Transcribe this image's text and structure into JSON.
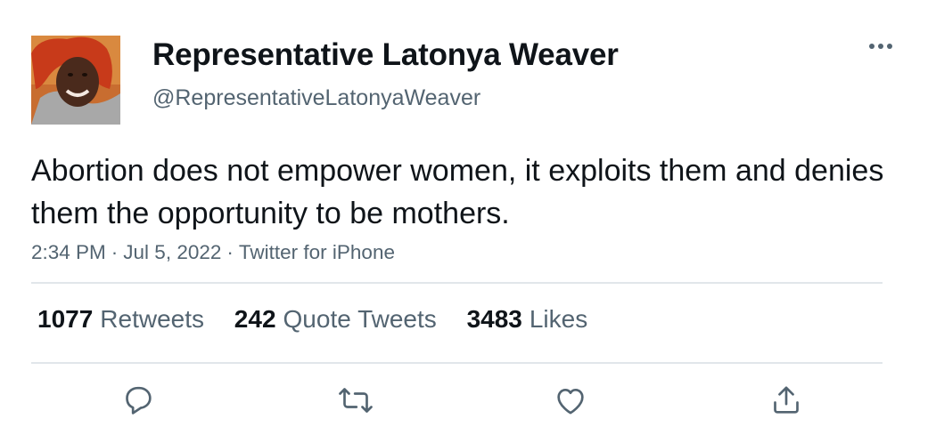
{
  "user": {
    "display_name": "Representative Latonya Weaver",
    "handle": "@RepresentativeLatonyaWeaver"
  },
  "tweet": {
    "text": "Abortion does not empower women, it exploits them and denies them the opportunity to be mothers.",
    "time": "2:34 PM",
    "date": "Jul 5, 2022",
    "source": "Twitter for iPhone",
    "separator": "·"
  },
  "stats": {
    "retweets": {
      "count": "1077",
      "label": "Retweets"
    },
    "quotes": {
      "count": "242",
      "label": "Quote Tweets"
    },
    "likes": {
      "count": "3483",
      "label": "Likes"
    }
  },
  "icons": {
    "more": "more-horizontal-icon",
    "reply": "reply-icon",
    "retweet": "retweet-icon",
    "like": "like-heart-icon",
    "share": "share-icon"
  },
  "colors": {
    "text_primary": "#0f1419",
    "text_secondary": "#536471",
    "divider": "#e1e6ea"
  }
}
